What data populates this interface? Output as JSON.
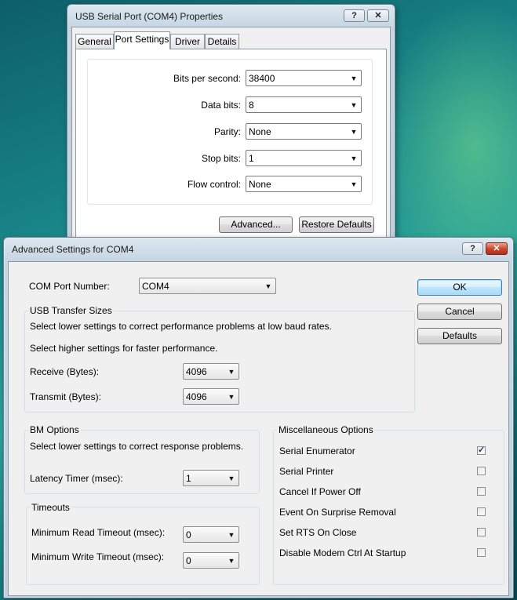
{
  "desktop": {},
  "back_dialog": {
    "title": "USB Serial Port (COM4) Properties",
    "tabs": [
      {
        "label": "General"
      },
      {
        "label": "Port Settings"
      },
      {
        "label": "Driver"
      },
      {
        "label": "Details"
      }
    ],
    "fields": [
      {
        "label": "Bits per second:",
        "value": "38400"
      },
      {
        "label": "Data bits:",
        "value": "8"
      },
      {
        "label": "Parity:",
        "value": "None"
      },
      {
        "label": "Stop bits:",
        "value": "1"
      },
      {
        "label": "Flow control:",
        "value": "None"
      }
    ],
    "advanced_label": "Advanced...",
    "restore_label": "Restore Defaults",
    "help_glyph": "?",
    "close_glyph": "✕"
  },
  "adv_dialog": {
    "title": "Advanced Settings for COM4",
    "help_glyph": "?",
    "close_glyph": "✕",
    "com_port_label": "COM Port Number:",
    "com_port_value": "COM4",
    "usb": {
      "title": "USB Transfer Sizes",
      "hint1": "Select lower settings to correct performance problems at low baud rates.",
      "hint2": "Select higher settings for faster performance.",
      "receive_label": "Receive (Bytes):",
      "receive_value": "4096",
      "transmit_label": "Transmit (Bytes):",
      "transmit_value": "4096"
    },
    "bm": {
      "title": "BM Options",
      "hint": "Select lower settings to correct response problems.",
      "latency_label": "Latency Timer (msec):",
      "latency_value": "1"
    },
    "timeouts": {
      "title": "Timeouts",
      "read_label": "Minimum Read Timeout (msec):",
      "read_value": "0",
      "write_label": "Minimum Write Timeout (msec):",
      "write_value": "0"
    },
    "misc": {
      "title": "Miscellaneous Options",
      "options": [
        {
          "label": "Serial Enumerator",
          "checked": true
        },
        {
          "label": "Serial Printer",
          "checked": false
        },
        {
          "label": "Cancel If Power Off",
          "checked": false
        },
        {
          "label": "Event On Surprise Removal",
          "checked": false
        },
        {
          "label": "Set RTS On Close",
          "checked": false
        },
        {
          "label": "Disable Modem Ctrl At Startup",
          "checked": false
        }
      ]
    },
    "ok_label": "OK",
    "cancel_label": "Cancel",
    "defaults_label": "Defaults"
  }
}
